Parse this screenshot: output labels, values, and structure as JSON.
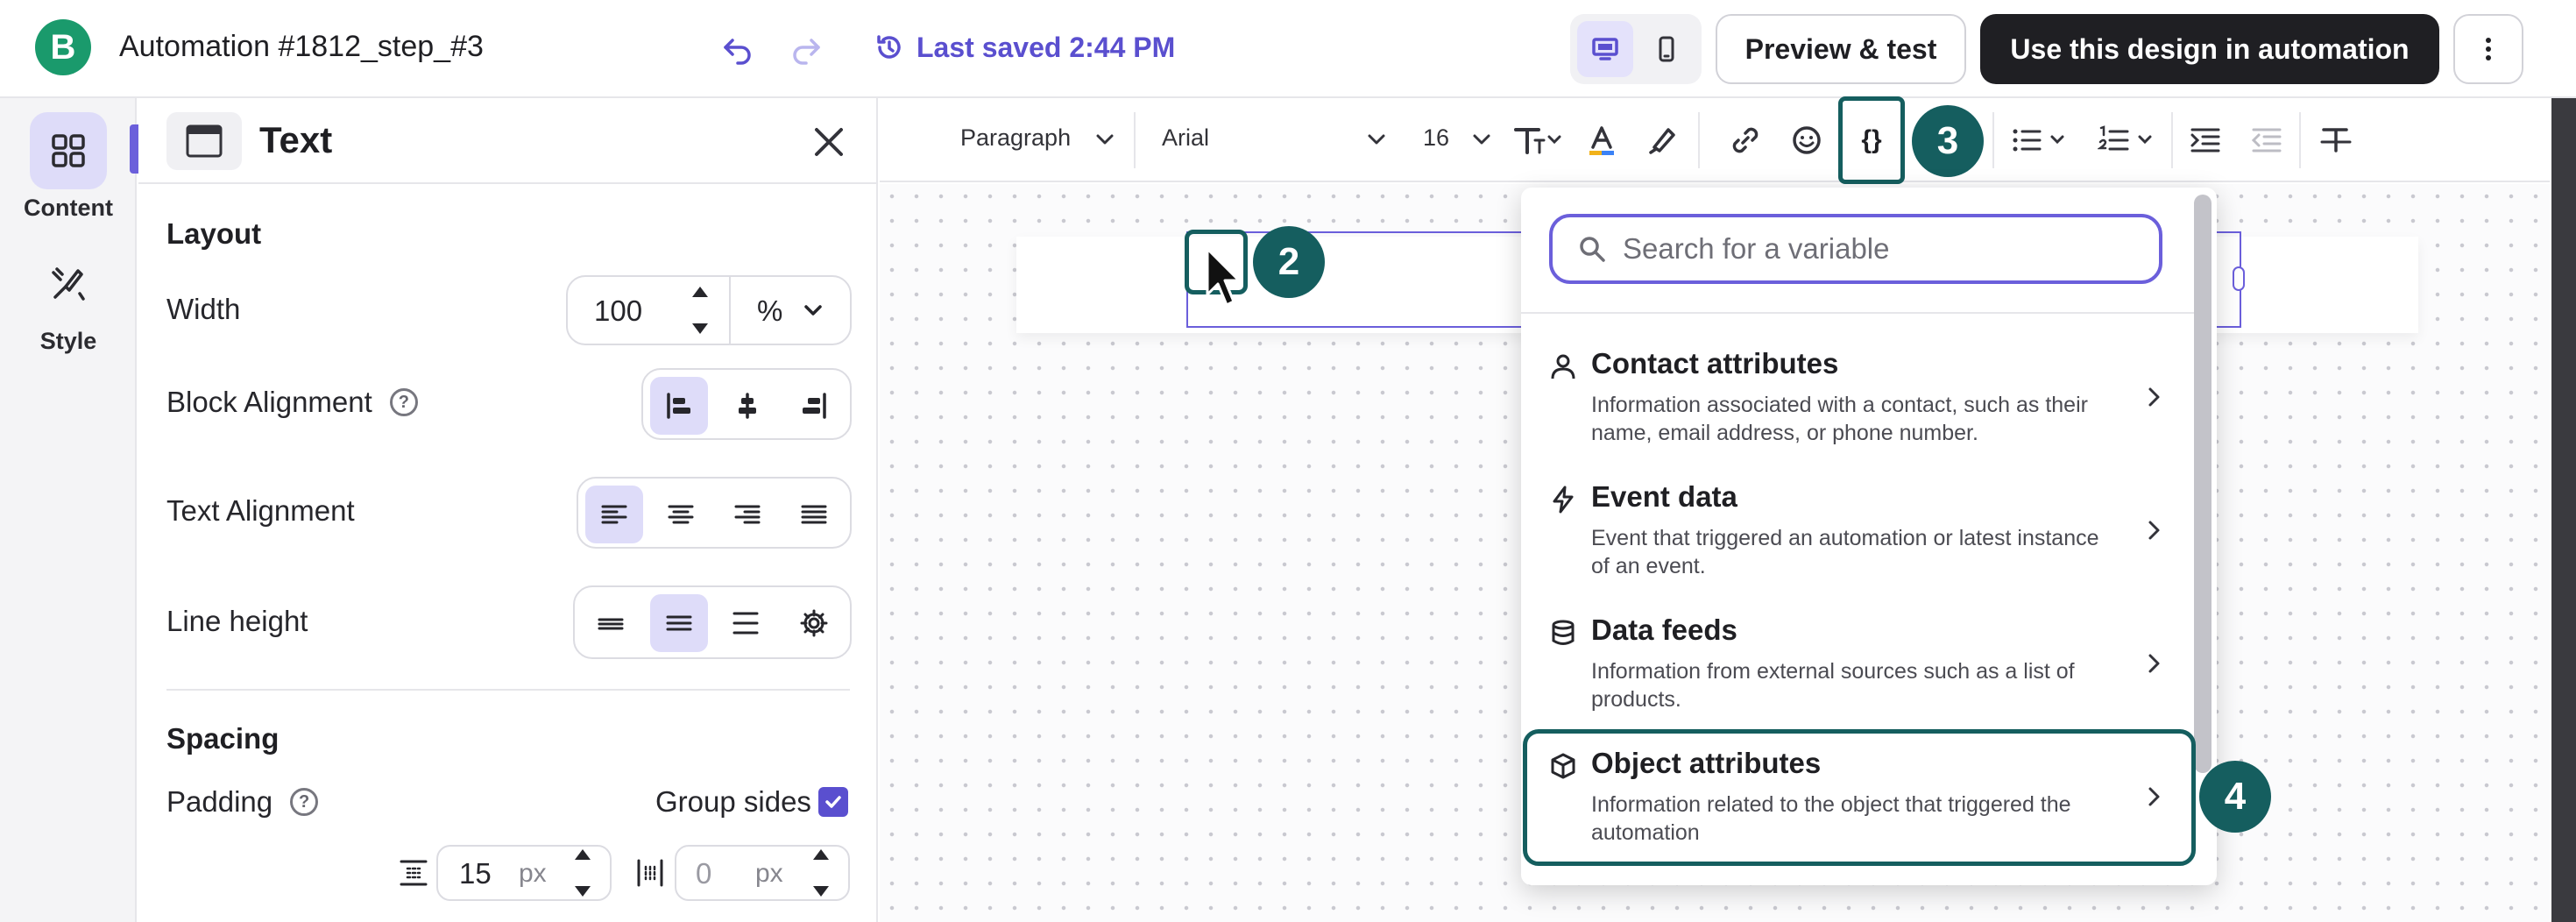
{
  "app": {
    "logo_letter": "B",
    "document_title": "Automation #1812_step_#3",
    "saved_status": "Last saved 2:44 PM",
    "preview_label": "Preview & test",
    "use_design_label": "Use this design in automation"
  },
  "rail": {
    "items": [
      {
        "label": "Content",
        "icon": "grid-icon",
        "active": true
      },
      {
        "label": "Style",
        "icon": "brush-icon",
        "active": false
      }
    ]
  },
  "panel": {
    "title": "Text",
    "layout": {
      "section_title": "Layout",
      "width_label": "Width",
      "width_value": "100",
      "width_unit": "%",
      "block_alignment_label": "Block Alignment",
      "text_alignment_label": "Text Alignment",
      "line_height_label": "Line height"
    },
    "spacing": {
      "section_title": "Spacing",
      "padding_label": "Padding",
      "group_sides_label": "Group sides",
      "group_sides_checked": true,
      "vertical_value": "15",
      "vertical_unit": "px",
      "horizontal_value": "0",
      "horizontal_unit": "px"
    }
  },
  "toolbar": {
    "block_type": "Paragraph",
    "font_family": "Arial",
    "font_size": "16",
    "variable_button": "{}"
  },
  "annotations": {
    "cursor_step": "2",
    "variable_step": "3",
    "object_step": "4"
  },
  "variable_menu": {
    "search_placeholder": "Search for a variable",
    "items": [
      {
        "title": "Contact attributes",
        "description": "Information associated with a contact, such as their name, email address, or phone number.",
        "icon": "person-icon"
      },
      {
        "title": "Event data",
        "description": "Event that triggered an automation or latest instance of an event.",
        "icon": "lightning-icon"
      },
      {
        "title": "Data feeds",
        "description": "Information from external sources such as a list of products.",
        "icon": "database-icon"
      },
      {
        "title": "Object attributes",
        "description": "Information related to the object that triggered the automation",
        "icon": "cube-icon"
      }
    ]
  },
  "colors": {
    "accent": "#5a4fcf",
    "highlight": "#155e5f",
    "brand": "#1a9a6c"
  }
}
